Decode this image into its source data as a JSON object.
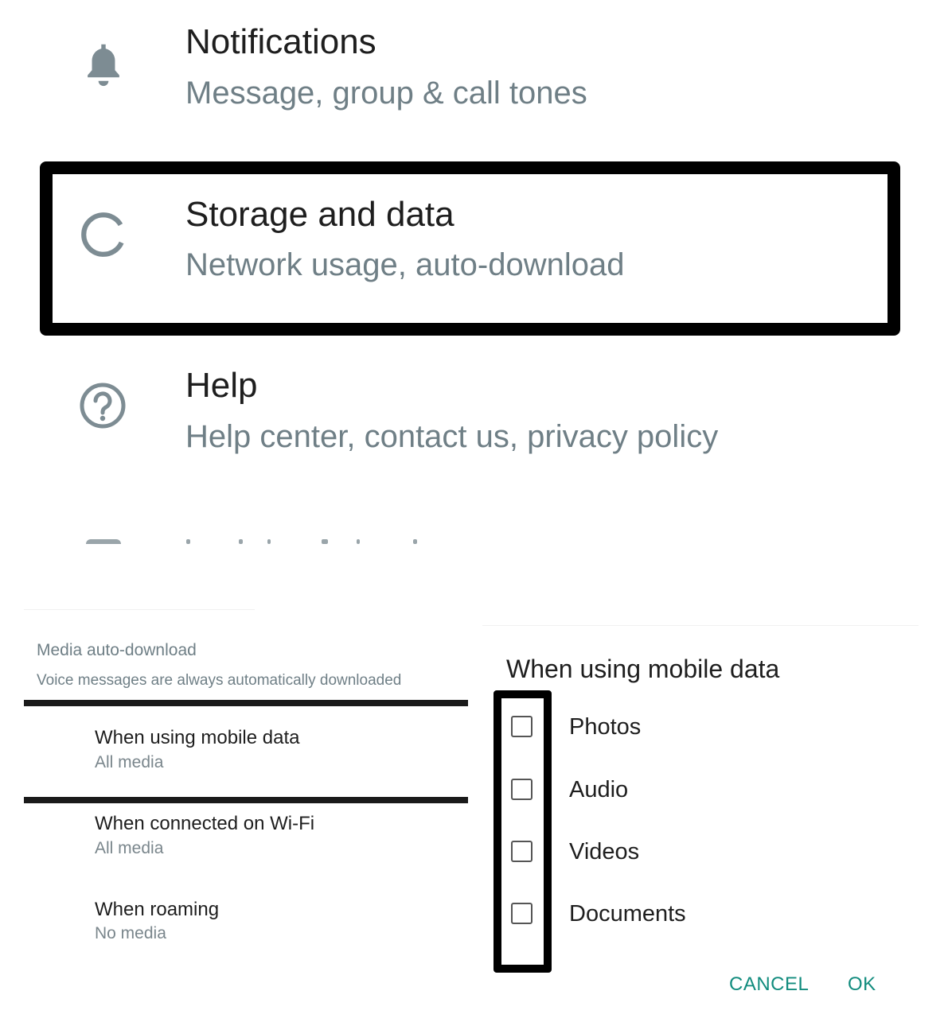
{
  "settings": {
    "items": [
      {
        "title": "Notifications",
        "subtitle": "Message, group & call tones",
        "icon": "bell-icon"
      },
      {
        "title": "Storage and data",
        "subtitle": "Network usage, auto-download",
        "icon": "storage-ring-icon"
      },
      {
        "title": "Help",
        "subtitle": "Help center, contact us, privacy policy",
        "icon": "help-circle-icon"
      }
    ]
  },
  "media_auto_download": {
    "heading": "Media auto-download",
    "note": "Voice messages are always automatically downloaded",
    "options": [
      {
        "title": "When using mobile data",
        "value": "All media"
      },
      {
        "title": "When connected on Wi-Fi",
        "value": "All media"
      },
      {
        "title": "When roaming",
        "value": "No media"
      }
    ]
  },
  "dialog": {
    "title": "When using mobile data",
    "checkboxes": [
      {
        "label": "Photos",
        "checked": false
      },
      {
        "label": "Audio",
        "checked": false
      },
      {
        "label": "Videos",
        "checked": false
      },
      {
        "label": "Documents",
        "checked": false
      }
    ],
    "cancel_label": "CANCEL",
    "ok_label": "OK"
  },
  "colors": {
    "accent": "#128c7e",
    "icon": "#7d8c93",
    "subtitle": "#6f7f86",
    "highlight_border": "#000000"
  }
}
